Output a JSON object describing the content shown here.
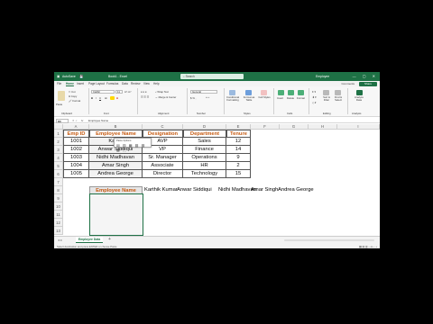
{
  "app": {
    "autosave": "AutoSave",
    "filename": "Book1 - Excel",
    "search_placeholder": "Search",
    "user": "Employee",
    "accent": "#1e7145",
    "header_text_color": "#c55a11"
  },
  "menu": {
    "items": [
      "File",
      "Home",
      "Insert",
      "Page Layout",
      "Formulas",
      "Data",
      "Review",
      "View",
      "Help"
    ],
    "active": "Home",
    "comments": "Comments",
    "share": "Share"
  },
  "ribbon": {
    "font_name": "Calibri",
    "font_size": "11",
    "number_format": "General",
    "groups": [
      "Clipboard",
      "Font",
      "Alignment",
      "Number",
      "Styles",
      "Cells",
      "Editing",
      "Analysis"
    ],
    "styles_buttons": [
      "Conditional Formatting",
      "Format as Table",
      "Cell Styles"
    ],
    "cells_buttons": [
      "Insert",
      "Delete",
      "Format"
    ],
    "editing_buttons": [
      "Sort & Filter",
      "Find & Select"
    ],
    "analysis_button": "Analyze Data"
  },
  "formula_bar": {
    "name_box": "B8",
    "fx": "fx",
    "content": "Employee Name"
  },
  "columns": [
    "A",
    "B",
    "C",
    "D",
    "E",
    "F",
    "G",
    "H",
    "I"
  ],
  "rows": [
    "1",
    "2",
    "3",
    "4",
    "5",
    "6",
    "7",
    "8",
    "9",
    "10",
    "11",
    "12",
    "13"
  ],
  "table": {
    "headers": [
      "Emp ID",
      "Employee Name",
      "Designation",
      "Department",
      "Tenure"
    ],
    "rows": [
      [
        "1001",
        "Karthi",
        "AVP",
        "Sales",
        "12"
      ],
      [
        "1002",
        "Anwar Siddiqui",
        "VP",
        "Finance",
        "14"
      ],
      [
        "1003",
        "Nidhi Madhavan",
        "Sr. Manager",
        "Operations",
        "9"
      ],
      [
        "1004",
        "Amar Singh",
        "Associate",
        "HR",
        "2"
      ],
      [
        "1005",
        "Andrea George",
        "Director",
        "Technology",
        "15"
      ]
    ]
  },
  "row8": {
    "label": "Employee Name",
    "values": [
      "Karthik Kumar",
      "Anwar Siddiqui",
      "Nidhi Madhavan",
      "Amar Singh",
      "Andrea George"
    ]
  },
  "mini_toolbar": {
    "title": "Paste Options:"
  },
  "sheet": {
    "tab": "Employee Data",
    "add": "+"
  },
  "status": {
    "text": "Select destination and press ENTER or choose Paste"
  }
}
